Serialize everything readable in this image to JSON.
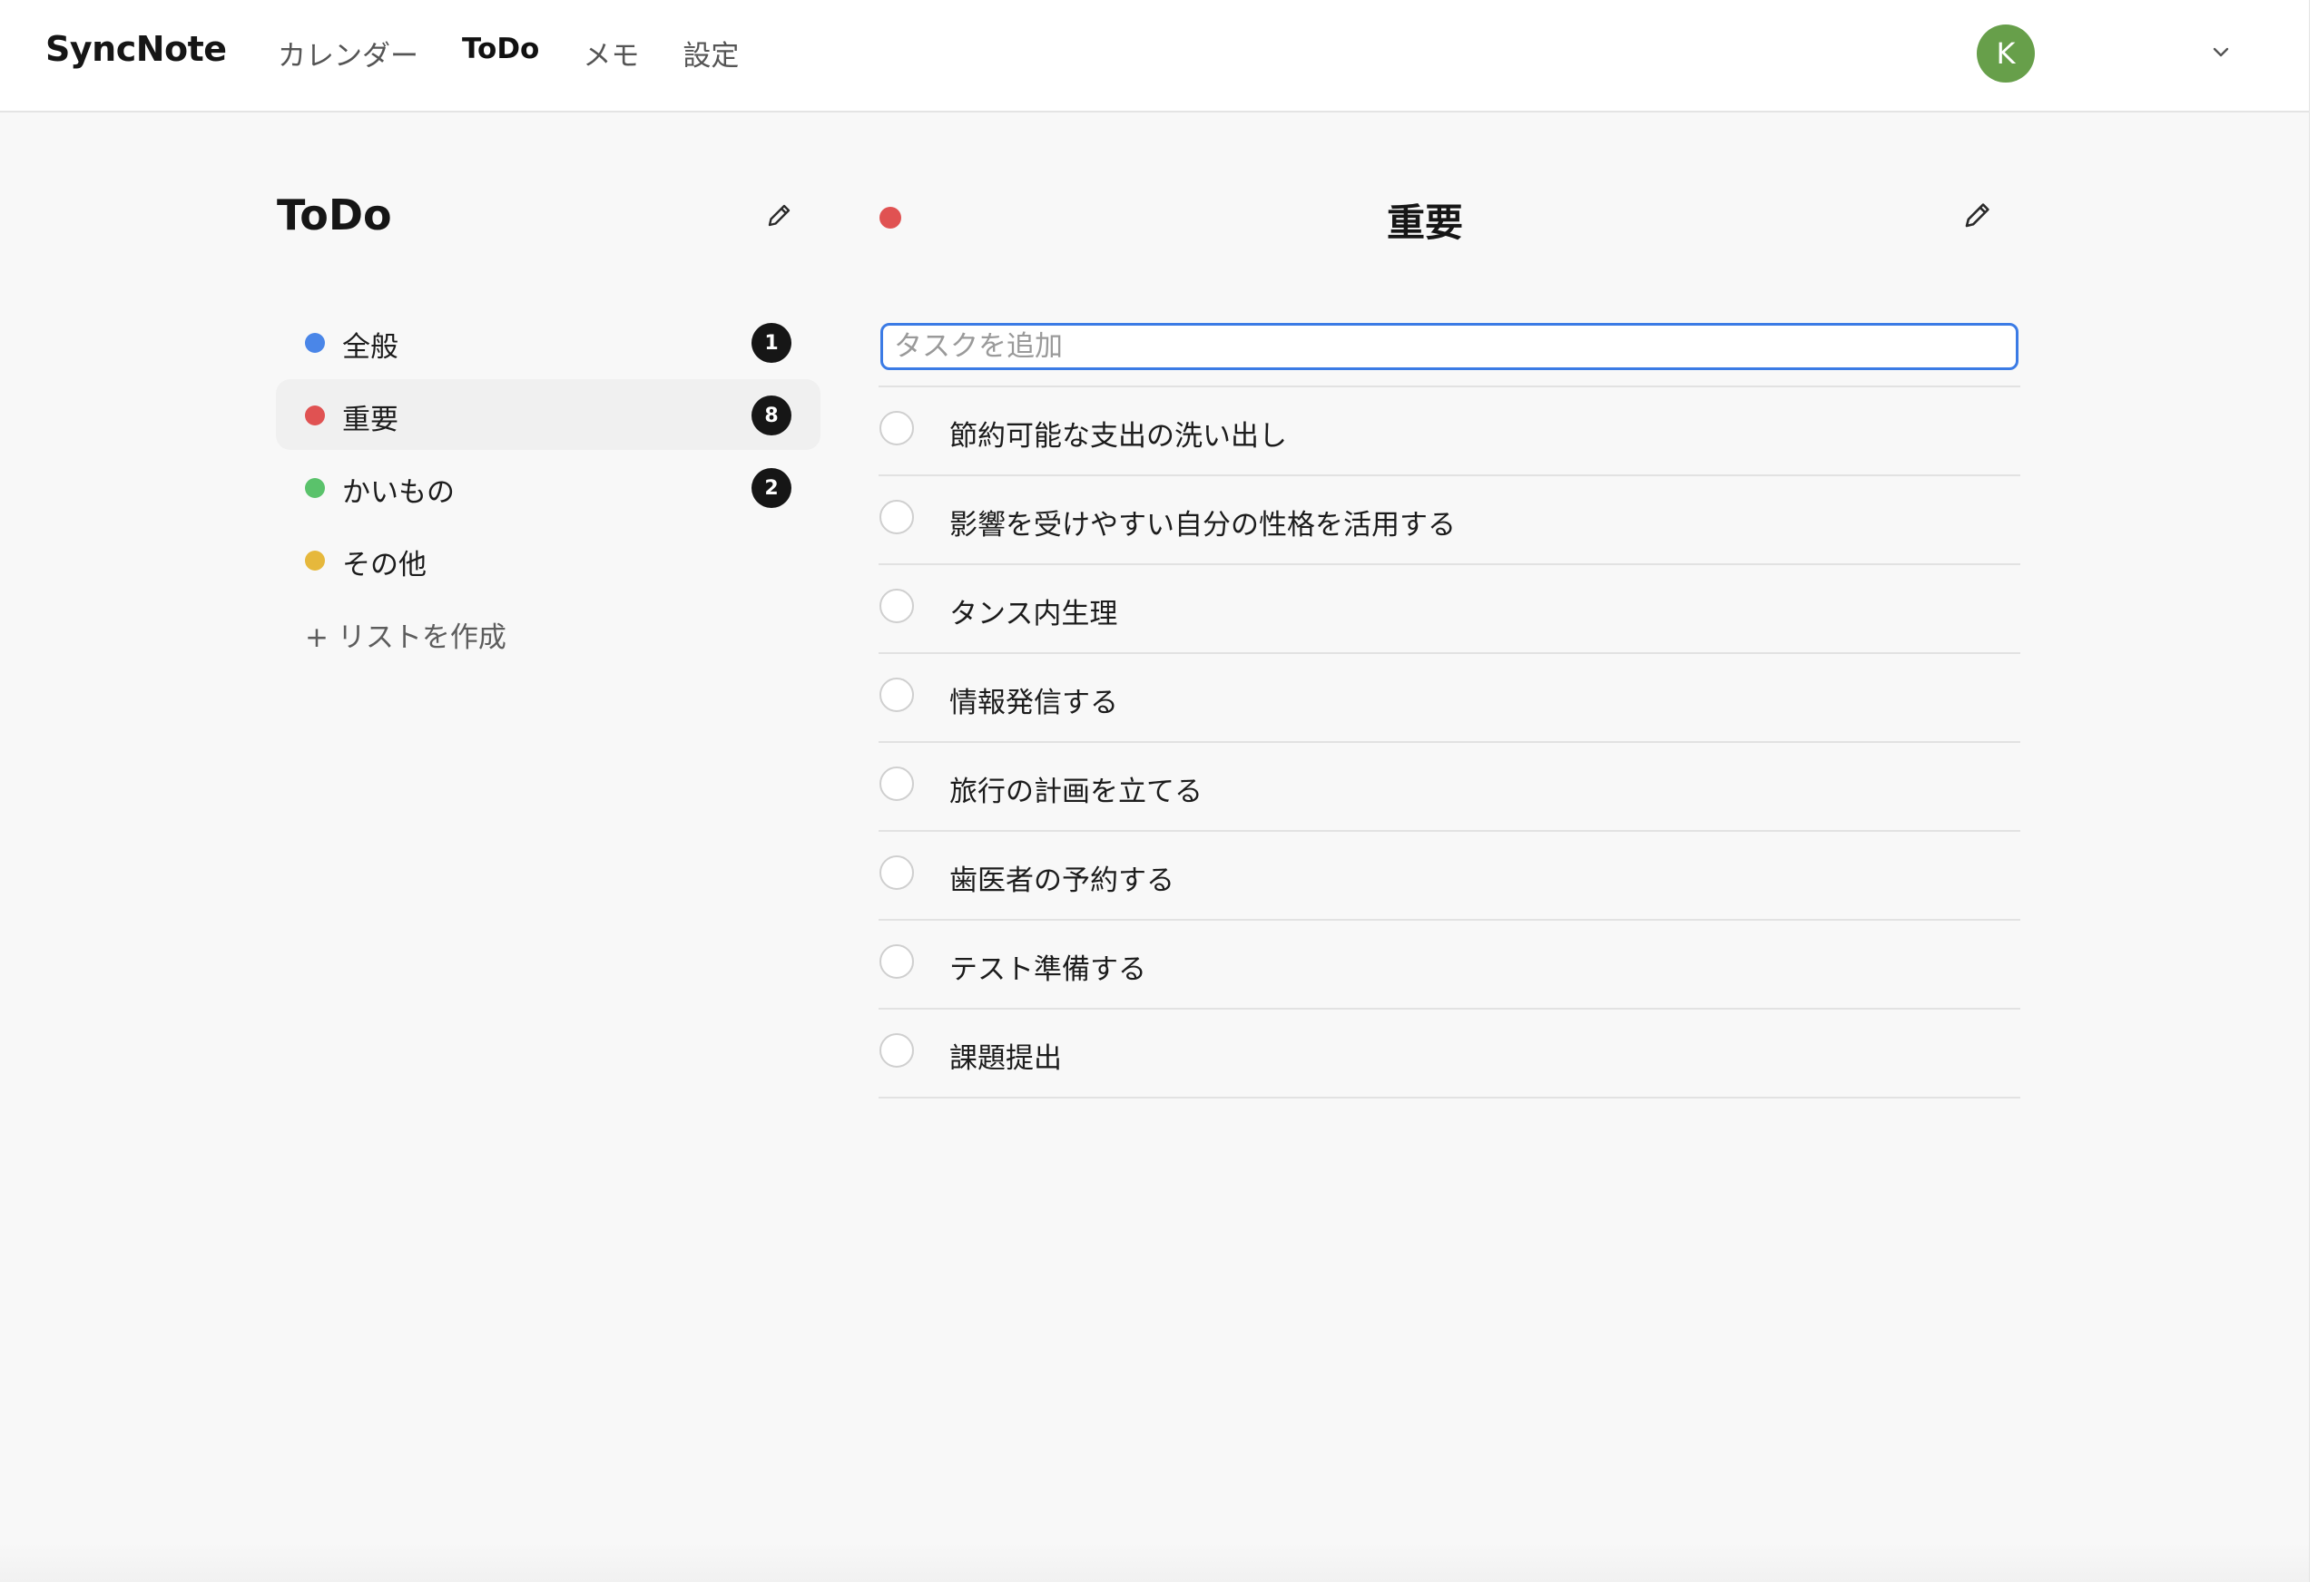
{
  "app": {
    "brand": "SyncNote",
    "nav": [
      {
        "label": "カレンダー",
        "active": false
      },
      {
        "label": "ToDo",
        "active": true
      },
      {
        "label": "メモ",
        "active": false
      },
      {
        "label": "設定",
        "active": false
      }
    ],
    "user": {
      "initial": "K",
      "avatar_color": "#679f4a"
    }
  },
  "sidebar": {
    "title": "ToDo",
    "edit_icon": "pencil-icon",
    "lists": [
      {
        "label": "全般",
        "color": "#4a86e8",
        "count": "1"
      },
      {
        "label": "重要",
        "color": "#e05252",
        "count": "8",
        "selected": true
      },
      {
        "label": "かいもの",
        "color": "#5ac26b",
        "count": "2"
      },
      {
        "label": "その他",
        "color": "#e6b83c",
        "count": ""
      }
    ],
    "create_label": "+ リストを作成"
  },
  "main": {
    "title": "重要",
    "color": "#e05252",
    "edit_icon": "pencil-icon",
    "input": {
      "placeholder": "タスクを追加",
      "value": ""
    },
    "tasks": [
      "節約可能な支出の洗い出し",
      "影響を受けやすい自分の性格を活用する",
      "タンス内生理",
      "情報発信する",
      "旅行の計画を立てる",
      "歯医者の予約する",
      "テスト準備する",
      "課題提出"
    ]
  },
  "colors": {
    "accent": "#3b7be5",
    "badge": "#161616",
    "background": "#f8f8f8"
  }
}
